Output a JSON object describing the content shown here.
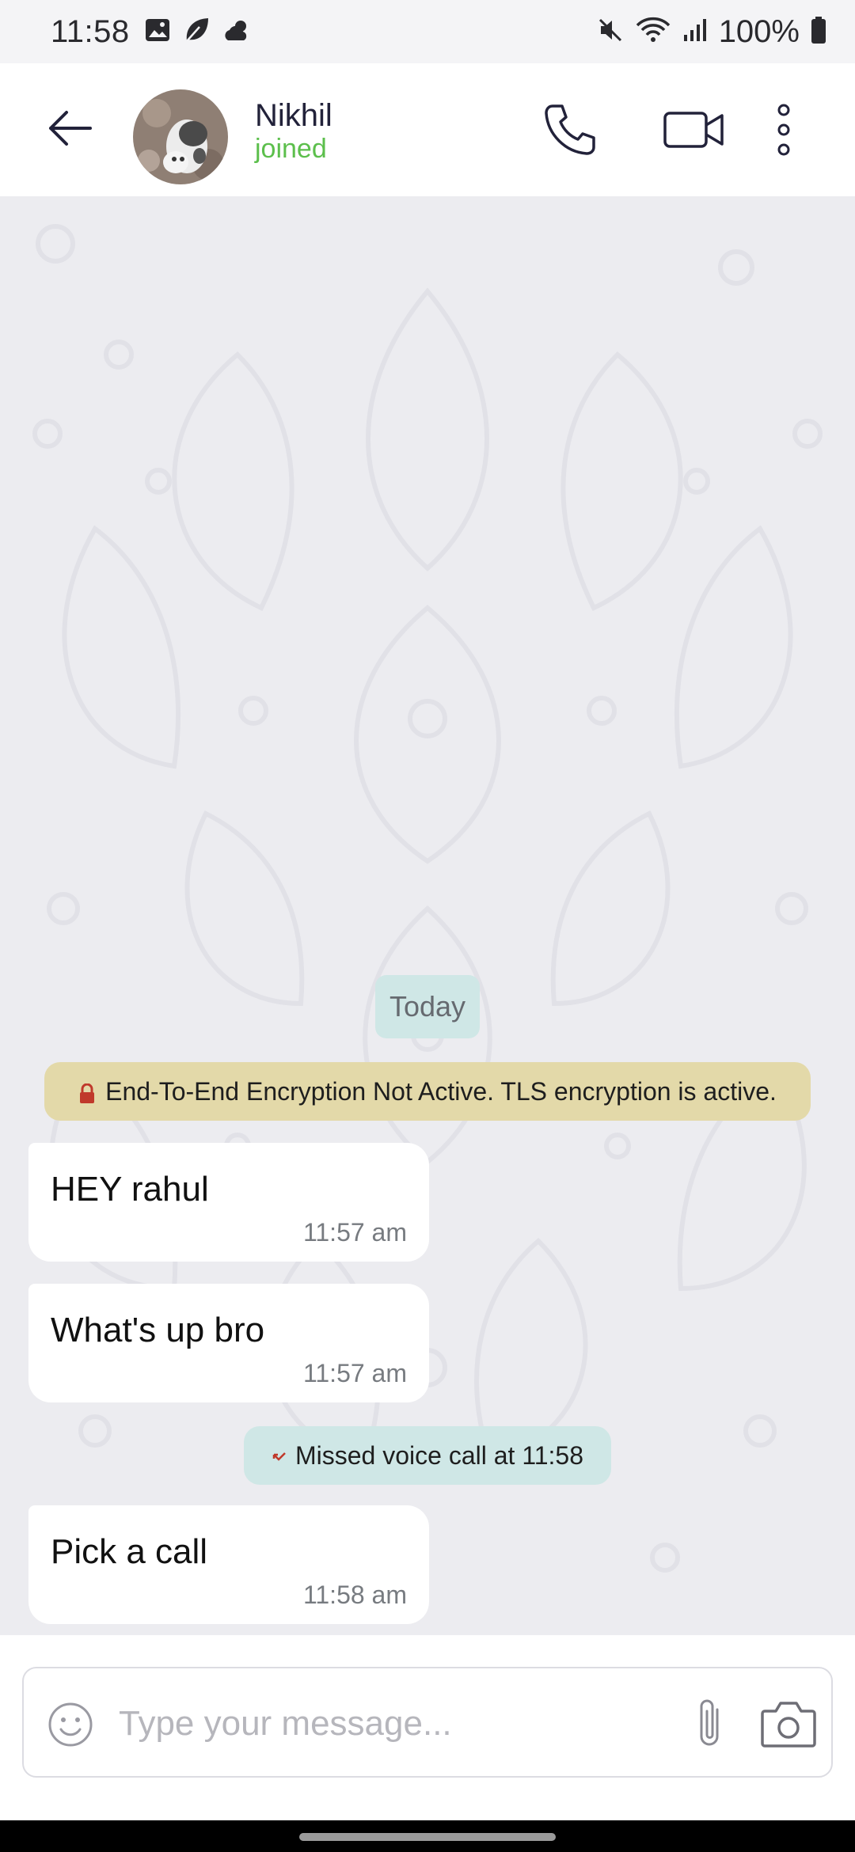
{
  "status_bar": {
    "time": "11:58",
    "battery": "100%",
    "left_icons": [
      "image-icon",
      "leaf-icon",
      "weather-icon"
    ],
    "right_icons": [
      "mute-icon",
      "wifi-icon",
      "signal-icon",
      "battery-icon"
    ]
  },
  "header": {
    "contact_name": "Nikhil",
    "contact_status": "joined",
    "status_color": "#5cbf4c",
    "icons": [
      "back-arrow-icon",
      "phone-icon",
      "video-camera-icon",
      "more-vertical-icon"
    ]
  },
  "chat": {
    "date_label": "Today",
    "encryption_notice": "End-To-End Encryption Not Active. TLS encryption is active.",
    "messages": [
      {
        "text": "HEY rahul",
        "time": "11:57 am"
      },
      {
        "text": "What's up bro",
        "time": "11:57 am"
      },
      {
        "text": "Pick a call",
        "time": "11:58 am"
      }
    ],
    "missed_call": "Missed voice call at 11:58"
  },
  "composer": {
    "placeholder": "Type your message...",
    "value": "",
    "icons": [
      "emoji-icon",
      "attach-icon",
      "camera-icon"
    ]
  },
  "colors": {
    "chat_background": "#ececf0",
    "system_chip": "#cfe7e6",
    "encryption_banner": "#e3d9a9",
    "bubble": "#ffffff"
  }
}
